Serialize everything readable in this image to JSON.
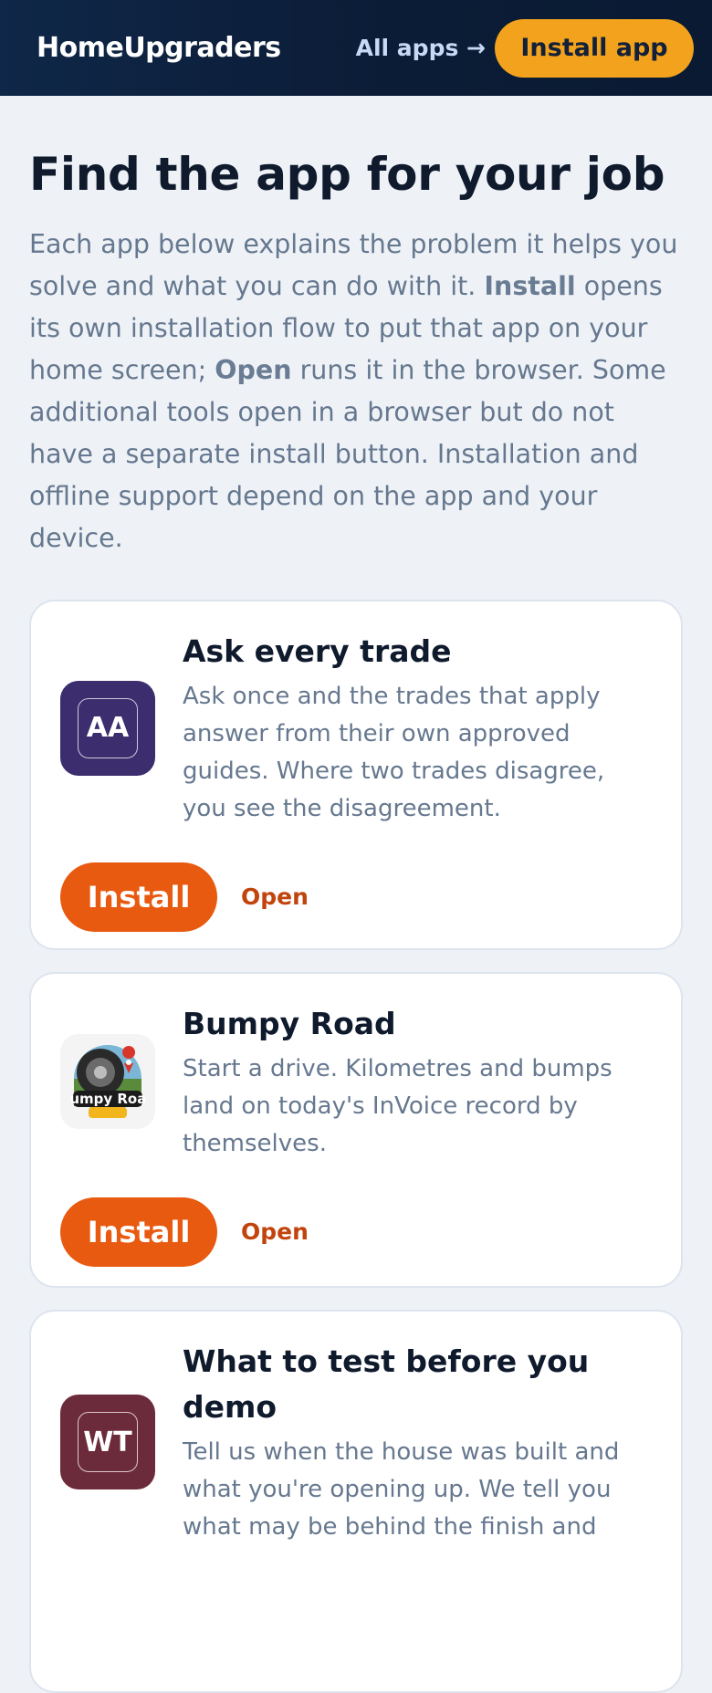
{
  "header": {
    "brand": "HomeUpgraders",
    "all_apps_label": "All apps →",
    "install_app_label": "Install app"
  },
  "intro": {
    "title": "Find the app for your job",
    "lead_1": "Each app below explains the problem it helps you solve and what you can do with it. ",
    "lead_install": "Install",
    "lead_2": " opens its own installation flow to put that app on your home screen; ",
    "lead_open": "Open",
    "lead_3": " runs it in the browser. Some additional tools open in a browser but do not have a separate install button. Installation and offline support depend on the app and your device."
  },
  "cards": [
    {
      "icon_text": "AA",
      "icon_color": "#3b2d6e",
      "title": "Ask every trade",
      "description": "Ask once and the trades that apply answer from their own approved guides. Where two trades disagree, you see the disagreement.",
      "install_label": "Install",
      "open_label": "Open"
    },
    {
      "icon_text": "Bumpy Road",
      "icon_name": "tire-logo-icon",
      "title": "Bumpy Road",
      "description": "Start a drive. Kilometres and bumps land on today's InVoice record by themselves.",
      "install_label": "Install",
      "open_label": "Open"
    },
    {
      "icon_text": "WT",
      "icon_color": "#6c2b3a",
      "title": "What to test before you demo",
      "description": "Tell us when the house was built and what you're opening up. We tell you what may be behind the finish and"
    }
  ],
  "colors": {
    "accent_orange": "#e85a10",
    "install_app_yellow": "#f2a21c",
    "header_navy": "#0b1c36"
  }
}
